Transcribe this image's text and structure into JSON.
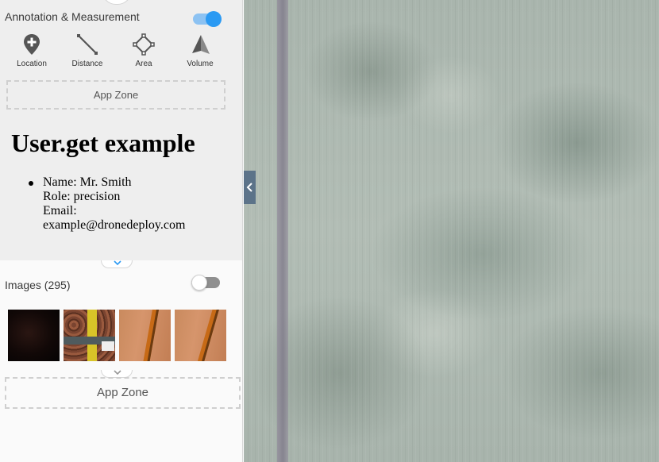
{
  "annotation": {
    "title": "Annotation & Measurement",
    "toggle_on": true,
    "tools": [
      {
        "label": "Location",
        "icon": "location-pin-icon"
      },
      {
        "label": "Distance",
        "icon": "line-icon"
      },
      {
        "label": "Area",
        "icon": "polygon-icon"
      },
      {
        "label": "Volume",
        "icon": "pyramid-icon"
      }
    ],
    "app_zone_label": "App Zone"
  },
  "user_example": {
    "title": "User.get example",
    "name": "Name: Mr. Smith",
    "role": "Role: precision",
    "email_label": "Email:",
    "email": "example@dronedeploy.com"
  },
  "images": {
    "title": "Images (295)",
    "toggle_on": false
  },
  "bottom_zone": {
    "label": "App Zone"
  },
  "colors": {
    "accent": "#2b9af3",
    "sidebar_bg": "#eeeeee",
    "collapse_tab": "#5c7389"
  }
}
